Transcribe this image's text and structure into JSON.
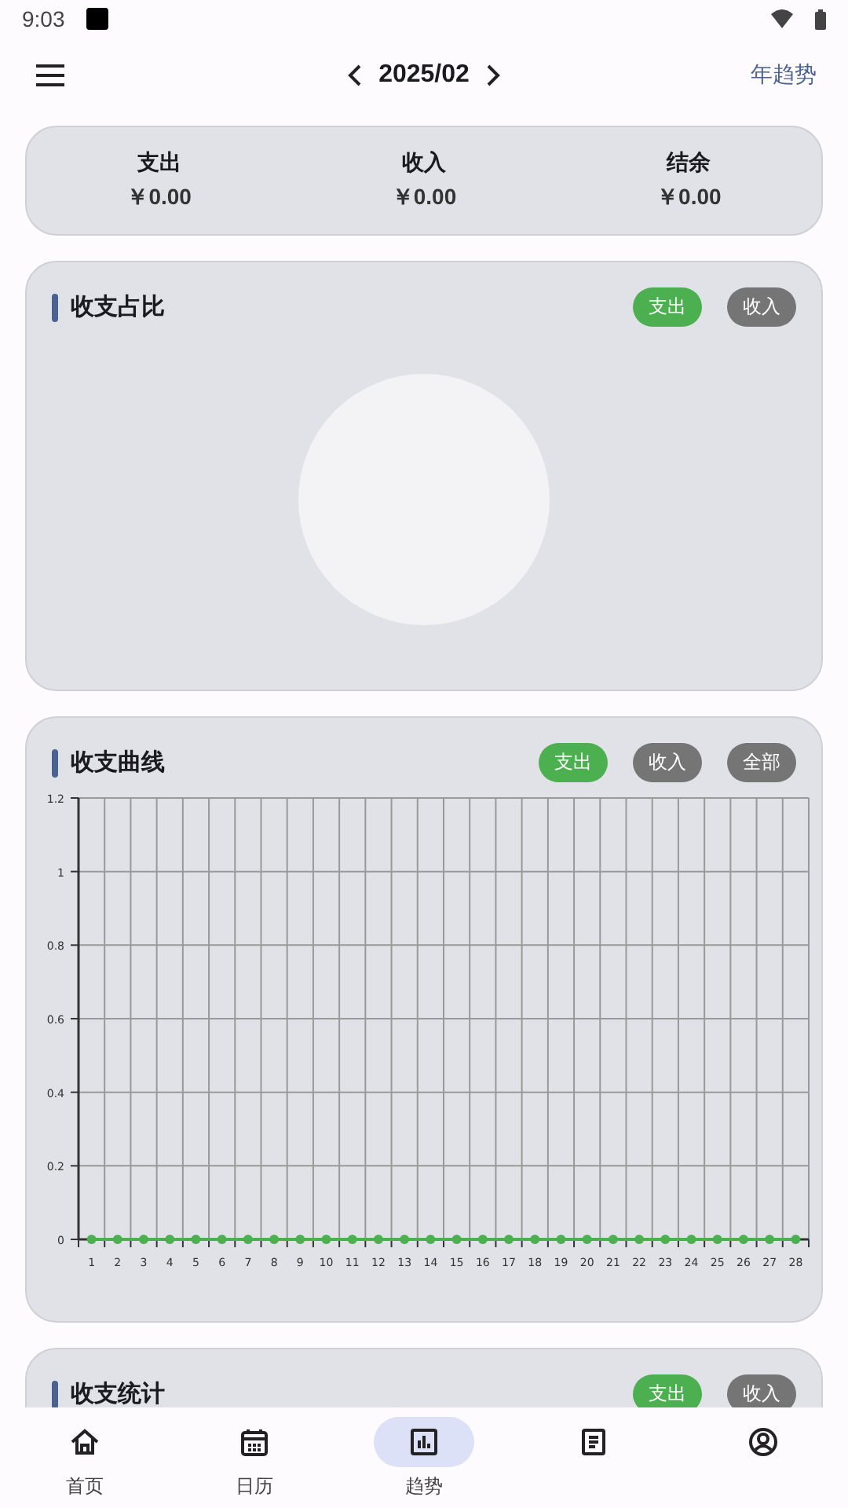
{
  "status_bar": {
    "time": "9:03"
  },
  "header": {
    "month": "2025/02",
    "link": "年趋势"
  },
  "summary": [
    {
      "label": "支出",
      "amount": "￥0.00"
    },
    {
      "label": "收入",
      "amount": "￥0.00"
    },
    {
      "label": "结余",
      "amount": "￥0.00"
    }
  ],
  "cards": [
    {
      "kind": "pie",
      "title": "收支占比",
      "chips": [
        {
          "label": "支出",
          "selected": true
        },
        {
          "label": "收入",
          "selected": false
        }
      ]
    },
    {
      "kind": "line",
      "title": "收支曲线",
      "chips": [
        {
          "label": "支出",
          "selected": true
        },
        {
          "label": "收入",
          "selected": false
        },
        {
          "label": "全部",
          "selected": false
        }
      ],
      "chart_data": {
        "type": "line",
        "x": [
          1,
          2,
          3,
          4,
          5,
          6,
          7,
          8,
          9,
          10,
          11,
          12,
          13,
          14,
          15,
          16,
          17,
          18,
          19,
          20,
          21,
          22,
          23,
          24,
          25,
          26,
          27,
          28
        ],
        "series": [
          {
            "color": "#4caf50",
            "marker": "circle",
            "values": [
              0,
              0,
              0,
              0,
              0,
              0,
              0,
              0,
              0,
              0,
              0,
              0,
              0,
              0,
              0,
              0,
              0,
              0,
              0,
              0,
              0,
              0,
              0,
              0,
              0,
              0,
              0,
              0
            ]
          }
        ],
        "xlim": [
          0.5,
          28.5
        ],
        "grid": true,
        "ylim": [
          0,
          1.2
        ],
        "yticks": [
          0,
          0.2,
          0.4,
          0.6,
          0.8,
          1,
          1.2
        ],
        "xticks": [
          1,
          2,
          3,
          4,
          5,
          6,
          7,
          8,
          9,
          10,
          11,
          12,
          13,
          14,
          15,
          16,
          17,
          18,
          19,
          20,
          21,
          22,
          23,
          24,
          25,
          26,
          27,
          28
        ]
      }
    },
    {
      "kind": "stats",
      "title": "收支统计",
      "chips": [
        {
          "label": "支出",
          "selected": true
        },
        {
          "label": "收入",
          "selected": false
        }
      ]
    }
  ],
  "nav": [
    {
      "kind": "home",
      "label": "首页",
      "selected": false
    },
    {
      "kind": "calendar",
      "label": "日历",
      "selected": false
    },
    {
      "kind": "chart",
      "label": "趋势",
      "selected": true
    },
    {
      "kind": "document",
      "selected": false
    },
    {
      "kind": "person",
      "selected": false
    }
  ]
}
